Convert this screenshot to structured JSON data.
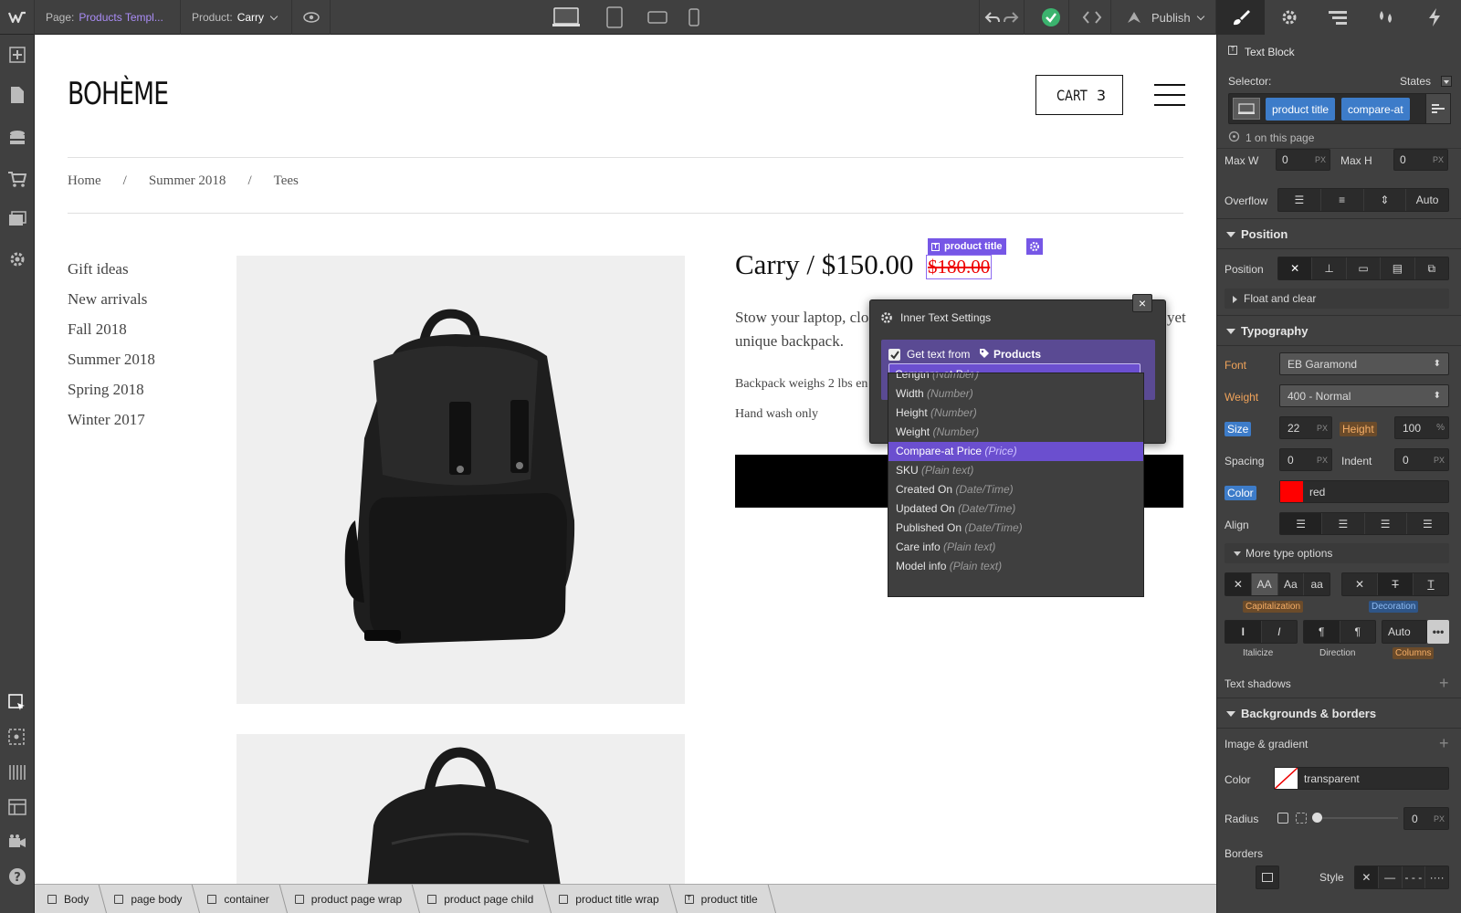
{
  "topbar": {
    "page_label": "Page:",
    "page_value": "Products Templ...",
    "product_label": "Product:",
    "product_value": "Carry",
    "publish_label": "Publish"
  },
  "canvas": {
    "brand": "BOHÈME",
    "cart_label": "CART",
    "cart_count": "3",
    "breadcrumb": [
      "Home",
      "/",
      "Summer 2018",
      "/",
      "Tees"
    ],
    "categories": [
      "Gift ideas",
      "New arrivals",
      "Fall 2018",
      "Summer 2018",
      "Spring 2018",
      "Winter 2017"
    ],
    "product_title": "Carry / $150.00",
    "compare_price": "$180.00",
    "desc_left": "Stow your laptop, clo",
    "desc_right": "yet",
    "desc_line2": "unique backpack.",
    "weight_text": "Backpack weighs 2 lbs en",
    "care_text": "Hand wash only",
    "selection_badge": "product title"
  },
  "modal": {
    "title": "Inner Text Settings",
    "get_text_label": "Get text from",
    "collection": "Products",
    "selected": "Compare-at Price"
  },
  "dropdown_options": [
    {
      "name": "Length",
      "type": "(Number)"
    },
    {
      "name": "Width",
      "type": "(Number)"
    },
    {
      "name": "Height",
      "type": "(Number)"
    },
    {
      "name": "Weight",
      "type": "(Number)"
    },
    {
      "name": "Compare-at Price",
      "type": "(Price)"
    },
    {
      "name": "SKU",
      "type": "(Plain text)"
    },
    {
      "name": "Created On",
      "type": "(Date/Time)"
    },
    {
      "name": "Updated On",
      "type": "(Date/Time)"
    },
    {
      "name": "Published On",
      "type": "(Date/Time)"
    },
    {
      "name": "Care info",
      "type": "(Plain text)"
    },
    {
      "name": "Model info",
      "type": "(Plain text)"
    }
  ],
  "panel": {
    "element_type": "Text Block",
    "selector_label": "Selector:",
    "states_label": "States",
    "classes": [
      "product title",
      "compare-at"
    ],
    "on_page": "1 on this page",
    "maxw_label": "Max W",
    "maxw_value": "0",
    "maxh_label": "Max H",
    "maxh_value": "0",
    "px": "PX",
    "overflow_label": "Overflow",
    "overflow_auto": "Auto",
    "position_section": "Position",
    "position_label": "Position",
    "float_clear": "Float and clear",
    "typography_section": "Typography",
    "font_label": "Font",
    "font_value": "EB Garamond",
    "weight_label": "Weight",
    "weight_value": "400 - Normal",
    "size_label": "Size",
    "size_value": "22",
    "height_label": "Height",
    "height_value": "100",
    "pct": "%",
    "spacing_label": "Spacing",
    "spacing_value": "0",
    "indent_label": "Indent",
    "indent_value": "0",
    "color_label": "Color",
    "color_value": "red",
    "color_swatch": "#ff0000",
    "align_label": "Align",
    "more_type": "More type options",
    "cap_aa1": "AA",
    "cap_aa2": "Aa",
    "cap_aa3": "aa",
    "capitalization": "Capitalization",
    "decoration": "Decoration",
    "italicize": "Italicize",
    "direction": "Direction",
    "columns": "Columns",
    "columns_auto": "Auto",
    "text_shadows": "Text shadows",
    "bg_section": "Backgrounds & borders",
    "image_gradient": "Image & gradient",
    "bg_color_label": "Color",
    "bg_color_value": "transparent",
    "radius_label": "Radius",
    "radius_value": "0",
    "borders_label": "Borders",
    "style_label": "Style"
  },
  "bottom_breadcrumb": [
    "Body",
    "page body",
    "container",
    "product page wrap",
    "product page child",
    "product title wrap",
    "product title"
  ]
}
